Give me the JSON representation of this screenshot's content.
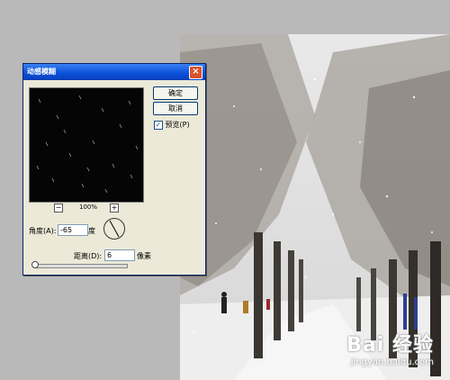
{
  "dialog": {
    "title": "动感模糊",
    "ok_label": "确定",
    "cancel_label": "取消",
    "preview_label": "预览(P)",
    "zoom_level": "100%",
    "zoom_out": "−",
    "zoom_in": "+",
    "angle_label": "角度(A):",
    "angle_value": "-65",
    "angle_unit": "度",
    "distance_label": "距离(D):",
    "distance_value": "6",
    "distance_unit": "像素",
    "close_label": "×"
  },
  "watermark": {
    "logo": "Bai 经验",
    "url": "jingyan.baidu.com"
  },
  "colors": {
    "title_bar": "#0a4fd8",
    "dialog_bg": "#ece9d8",
    "canvas_bg": "#b9b9b9"
  }
}
